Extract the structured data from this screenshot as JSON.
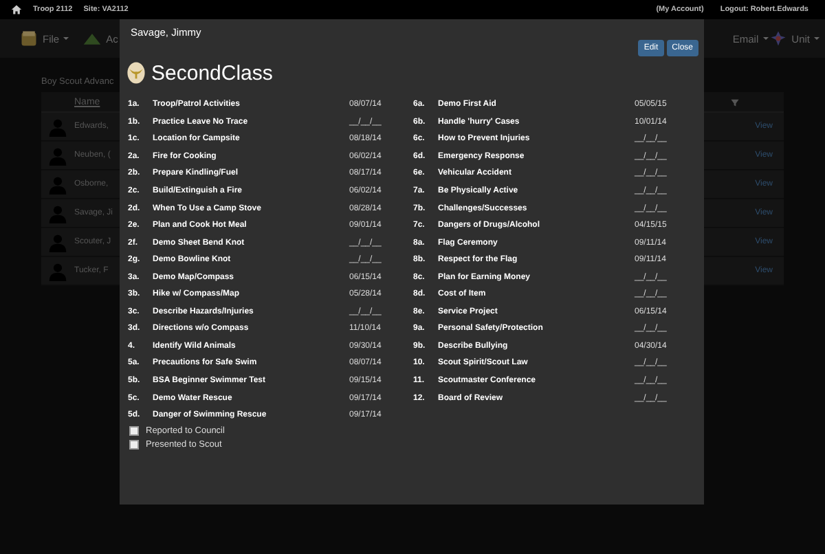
{
  "top_bar": {
    "troop": "Troop 2112",
    "site": "Site:  VA2112",
    "account": "(My Account)",
    "logout": "Logout: Robert.Edwards"
  },
  "nav": [
    {
      "label": "File",
      "kind": "file",
      "caret": true
    },
    {
      "label": "Ac",
      "kind": "tent",
      "caret": false
    },
    {
      "label": "Email",
      "kind": "none",
      "caret": true
    },
    {
      "label": "Unit",
      "kind": "emblem",
      "caret": true
    }
  ],
  "page": {
    "heading": "Boy Scout Advanc",
    "table": {
      "column": "Name",
      "rows": [
        {
          "name": "Edwards,",
          "action": "View"
        },
        {
          "name": "Neuben, (",
          "action": "View"
        },
        {
          "name": "Osborne,",
          "action": "View"
        },
        {
          "name": "Savage, Ji",
          "action": "View"
        },
        {
          "name": "Scouter, J",
          "action": "View"
        },
        {
          "name": "Tucker, F",
          "action": "View"
        }
      ]
    }
  },
  "dialog": {
    "title": "Savage, Jimmy",
    "buttons": [
      "Edit",
      "Close"
    ],
    "rank": "SecondClass",
    "requirements": [
      [
        {
          "num": "1a.",
          "name": "Troop/Patrol Activities",
          "date": "08/07/14"
        },
        {
          "num": "1b.",
          "name": "Practice Leave No Trace",
          "date": "__/__/__"
        },
        {
          "num": "1c.",
          "name": "Location for Campsite",
          "date": "08/18/14"
        },
        {
          "num": "2a.",
          "name": "Fire for Cooking",
          "date": "06/02/14"
        },
        {
          "num": "2b.",
          "name": "Prepare Kindling/Fuel",
          "date": "08/17/14"
        },
        {
          "num": "2c.",
          "name": "Build/Extinguish a Fire",
          "date": "06/02/14"
        },
        {
          "num": "2d.",
          "name": "When To Use a Camp Stove",
          "date": "08/28/14"
        },
        {
          "num": "2e.",
          "name": "Plan and Cook Hot Meal",
          "date": "09/01/14"
        },
        {
          "num": "2f.",
          "name": "Demo Sheet Bend Knot",
          "date": "__/__/__"
        },
        {
          "num": "2g.",
          "name": "Demo Bowline Knot",
          "date": "__/__/__"
        },
        {
          "num": "3a.",
          "name": "Demo Map/Compass",
          "date": "06/15/14"
        },
        {
          "num": "3b.",
          "name": "Hike w/ Compass/Map",
          "date": "05/28/14"
        },
        {
          "num": "3c.",
          "name": "Describe Hazards/Injuries",
          "date": "__/__/__"
        },
        {
          "num": "3d.",
          "name": "Directions w/o Compass",
          "date": "11/10/14"
        },
        {
          "num": "4.",
          "name": "Identify Wild Animals",
          "date": "09/30/14"
        },
        {
          "num": "5a.",
          "name": "Precautions for Safe Swim",
          "date": "08/07/14"
        },
        {
          "num": "5b.",
          "name": "BSA Beginner Swimmer Test",
          "date": "09/15/14"
        },
        {
          "num": "5c.",
          "name": "Demo Water Rescue",
          "date": "09/17/14"
        },
        {
          "num": "5d.",
          "name": "Danger of Swimming Rescue",
          "date": "09/17/14"
        }
      ],
      [
        {
          "num": "6a.",
          "name": "Demo First Aid",
          "date": "05/05/15"
        },
        {
          "num": "6b.",
          "name": "Handle 'hurry' Cases",
          "date": "10/01/14"
        },
        {
          "num": "6c.",
          "name": "How to Prevent Injuries",
          "date": "__/__/__"
        },
        {
          "num": "6d.",
          "name": "Emergency Response",
          "date": "__/__/__"
        },
        {
          "num": "6e.",
          "name": "Vehicular Accident",
          "date": "__/__/__"
        },
        {
          "num": "7a.",
          "name": "Be Physically Active",
          "date": "__/__/__"
        },
        {
          "num": "7b.",
          "name": "Challenges/Successes",
          "date": "__/__/__"
        },
        {
          "num": "7c.",
          "name": "Dangers of Drugs/Alcohol",
          "date": "04/15/15"
        },
        {
          "num": "8a.",
          "name": "Flag Ceremony",
          "date": "09/11/14"
        },
        {
          "num": "8b.",
          "name": "Respect for the Flag",
          "date": "09/11/14"
        },
        {
          "num": "8c.",
          "name": "Plan for Earning Money",
          "date": "__/__/__"
        },
        {
          "num": "8d.",
          "name": "Cost of Item",
          "date": "__/__/__"
        },
        {
          "num": "8e.",
          "name": "Service Project",
          "date": "06/15/14"
        },
        {
          "num": "9a.",
          "name": "Personal Safety/Protection",
          "date": "__/__/__"
        },
        {
          "num": "9b.",
          "name": "Describe Bullying",
          "date": "04/30/14"
        },
        {
          "num": "10.",
          "name": "Scout Spirit/Scout Law",
          "date": "__/__/__"
        },
        {
          "num": "11.",
          "name": "Scoutmaster Conference",
          "date": "__/__/__"
        },
        {
          "num": "12.",
          "name": "Board of Review",
          "date": "__/__/__"
        }
      ]
    ],
    "checkboxes": [
      {
        "label": "Reported to Council",
        "checked": false
      },
      {
        "label": "Presented to Scout",
        "checked": false
      }
    ]
  }
}
